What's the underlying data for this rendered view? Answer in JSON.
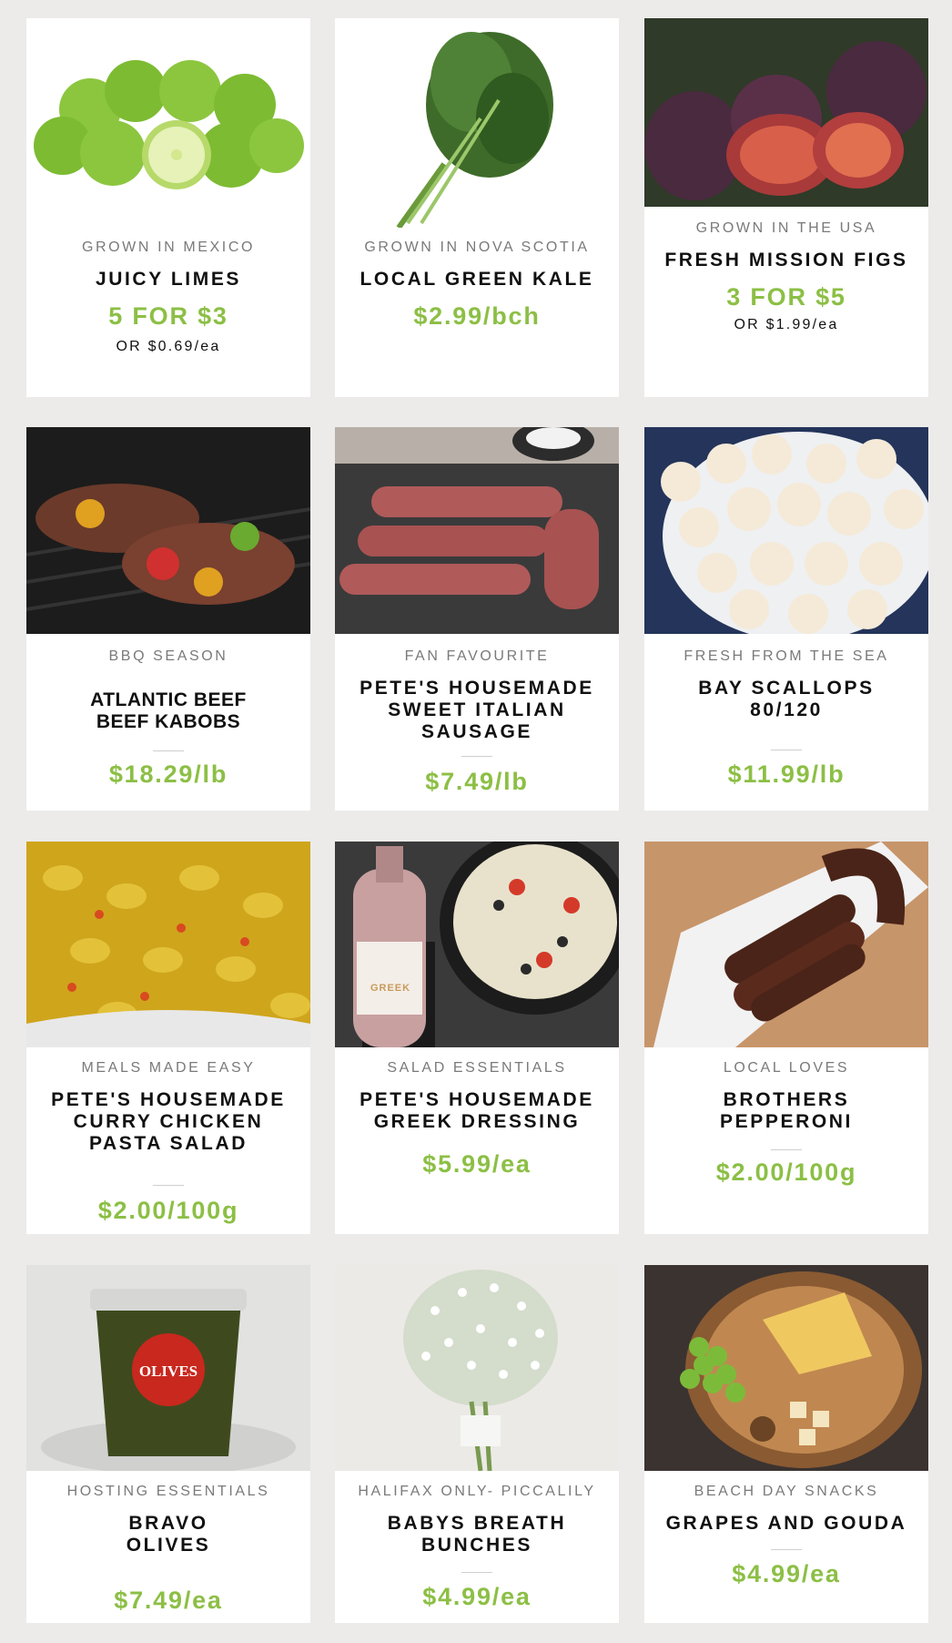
{
  "products": [
    {
      "origin": "GROWN IN MEXICO",
      "title": [
        "JUICY LIMES"
      ],
      "price": "5 FOR $3",
      "sub": "OR $0.69/ea"
    },
    {
      "origin": "GROWN IN NOVA SCOTIA",
      "title": [
        "LOCAL GREEN KALE"
      ],
      "price": "$2.99/bch",
      "sub": ""
    },
    {
      "origin": "GROWN IN THE USA",
      "title": [
        "FRESH MISSION FIGS"
      ],
      "price": "3 FOR $5",
      "sub": "OR $1.99/ea"
    },
    {
      "origin": "BBQ SEASON",
      "title": [
        "ATLANTIC BEEF",
        "BEEF KABOBS"
      ],
      "price": "$18.29/lb",
      "sub": ""
    },
    {
      "origin": "FAN FAVOURITE",
      "title": [
        "PETE'S HOUSEMADE",
        "SWEET ITALIAN",
        "SAUSAGE"
      ],
      "price": "$7.49/lb",
      "sub": ""
    },
    {
      "origin": "FRESH FROM THE SEA",
      "title": [
        "BAY SCALLOPS",
        "80/120"
      ],
      "price": "$11.99/lb",
      "sub": ""
    },
    {
      "origin": "MEALS MADE EASY",
      "title": [
        "PETE'S HOUSEMADE",
        "CURRY CHICKEN",
        "PASTA SALAD"
      ],
      "price": "$2.00/100g",
      "sub": ""
    },
    {
      "origin": "SALAD ESSENTIALS",
      "title": [
        "PETE'S HOUSEMADE",
        "GREEK DRESSING"
      ],
      "price": "$5.99/ea",
      "sub": ""
    },
    {
      "origin": "LOCAL LOVES",
      "title": [
        "BROTHERS",
        "PEPPERONI"
      ],
      "price": "$2.00/100g",
      "sub": ""
    },
    {
      "origin": "HOSTING ESSENTIALS",
      "title": [
        "BRAVO",
        "OLIVES"
      ],
      "price": "$7.49/ea",
      "sub": ""
    },
    {
      "origin": "HALIFAX ONLY- PICCALILY",
      "title": [
        "BABYS BREATH",
        "BUNCHES"
      ],
      "price": "$4.99/ea",
      "sub": ""
    },
    {
      "origin": "BEACH DAY SNACKS",
      "title": [
        "GRAPES AND GOUDA"
      ],
      "price": "$4.99/ea",
      "sub": ""
    }
  ],
  "labels": {
    "olives_jar": "OLIVES",
    "dressing_bottle": "GREEK"
  },
  "colors": {
    "price_green": "#8cbf45",
    "page_bg": "#ecebea"
  }
}
